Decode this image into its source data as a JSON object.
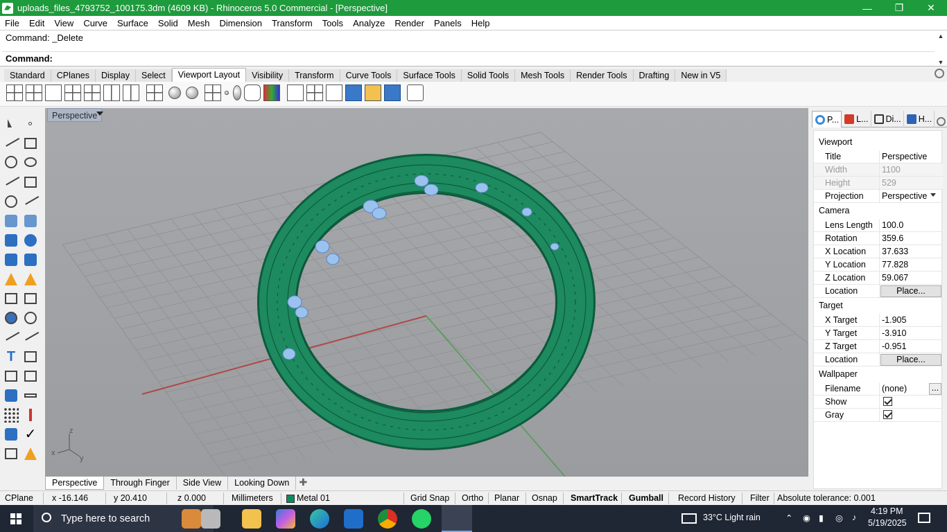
{
  "window": {
    "title": "uploads_files_4793752_100175.3dm (4609 KB) - Rhinoceros 5.0 Commercial - [Perspective]"
  },
  "menu": [
    "File",
    "Edit",
    "View",
    "Curve",
    "Surface",
    "Solid",
    "Mesh",
    "Dimension",
    "Transform",
    "Tools",
    "Analyze",
    "Render",
    "Panels",
    "Help"
  ],
  "command": {
    "history": "Command: _Delete",
    "prompt": "Command:"
  },
  "tabs": [
    "Standard",
    "CPlanes",
    "Display",
    "Select",
    "Viewport Layout",
    "Visibility",
    "Transform",
    "Curve Tools",
    "Surface Tools",
    "Solid Tools",
    "Mesh Tools",
    "Render Tools",
    "Drafting",
    "New in V5"
  ],
  "active_tab": "Viewport Layout",
  "viewport": {
    "title": "Perspective",
    "axis_labels": {
      "z": "z",
      "x": "x",
      "y": "y"
    }
  },
  "view_tabs": [
    "Perspective",
    "Through Finger",
    "Side View",
    "Looking Down"
  ],
  "status": {
    "cplane": "CPlane",
    "x": "x -16.146",
    "y": "y 20.410",
    "z": "z 0.000",
    "units": "Millimeters",
    "layer": "Metal 01",
    "layer_color": "#0e8a5f",
    "toggles": [
      {
        "label": "Grid Snap",
        "bold": false
      },
      {
        "label": "Ortho",
        "bold": false
      },
      {
        "label": "Planar",
        "bold": false
      },
      {
        "label": "Osnap",
        "bold": false
      },
      {
        "label": "SmartTrack",
        "bold": true
      },
      {
        "label": "Gumball",
        "bold": true
      },
      {
        "label": "Record History",
        "bold": false
      },
      {
        "label": "Filter",
        "bold": false
      }
    ],
    "tolerance": "Absolute tolerance: 0.001"
  },
  "panel": {
    "tabs": [
      {
        "label": "P...",
        "icon": "properties-icon"
      },
      {
        "label": "L...",
        "icon": "layers-icon"
      },
      {
        "label": "Di...",
        "icon": "display-icon"
      },
      {
        "label": "H...",
        "icon": "help-icon"
      }
    ],
    "sections": {
      "viewport": "Viewport",
      "camera": "Camera",
      "target": "Target",
      "wallpaper": "Wallpaper"
    },
    "viewport_rows": [
      {
        "key": "Title",
        "value": "Perspective"
      },
      {
        "key": "Width",
        "value": "1100"
      },
      {
        "key": "Height",
        "value": "529"
      },
      {
        "key": "Projection",
        "value": "Perspective"
      }
    ],
    "camera_rows": [
      {
        "key": "Lens Length",
        "value": "100.0"
      },
      {
        "key": "Rotation",
        "value": "359.6"
      },
      {
        "key": "X Location",
        "value": "37.633"
      },
      {
        "key": "Y Location",
        "value": "77.828"
      },
      {
        "key": "Z Location",
        "value": "59.067"
      },
      {
        "key": "Location",
        "value": "Place..."
      }
    ],
    "target_rows": [
      {
        "key": "X Target",
        "value": "-1.905"
      },
      {
        "key": "Y Target",
        "value": "-3.910"
      },
      {
        "key": "Z Target",
        "value": "-0.951"
      },
      {
        "key": "Location",
        "value": "Place..."
      }
    ],
    "wallpaper_rows": [
      {
        "key": "Filename",
        "value": "(none)",
        "button": "..."
      },
      {
        "key": "Show",
        "checked": true
      },
      {
        "key": "Gray",
        "checked": true
      }
    ]
  },
  "taskbar": {
    "search_placeholder": "Type here to search",
    "weather": "33°C  Light rain",
    "time": "4:19 PM",
    "date": "5/19/2025"
  }
}
